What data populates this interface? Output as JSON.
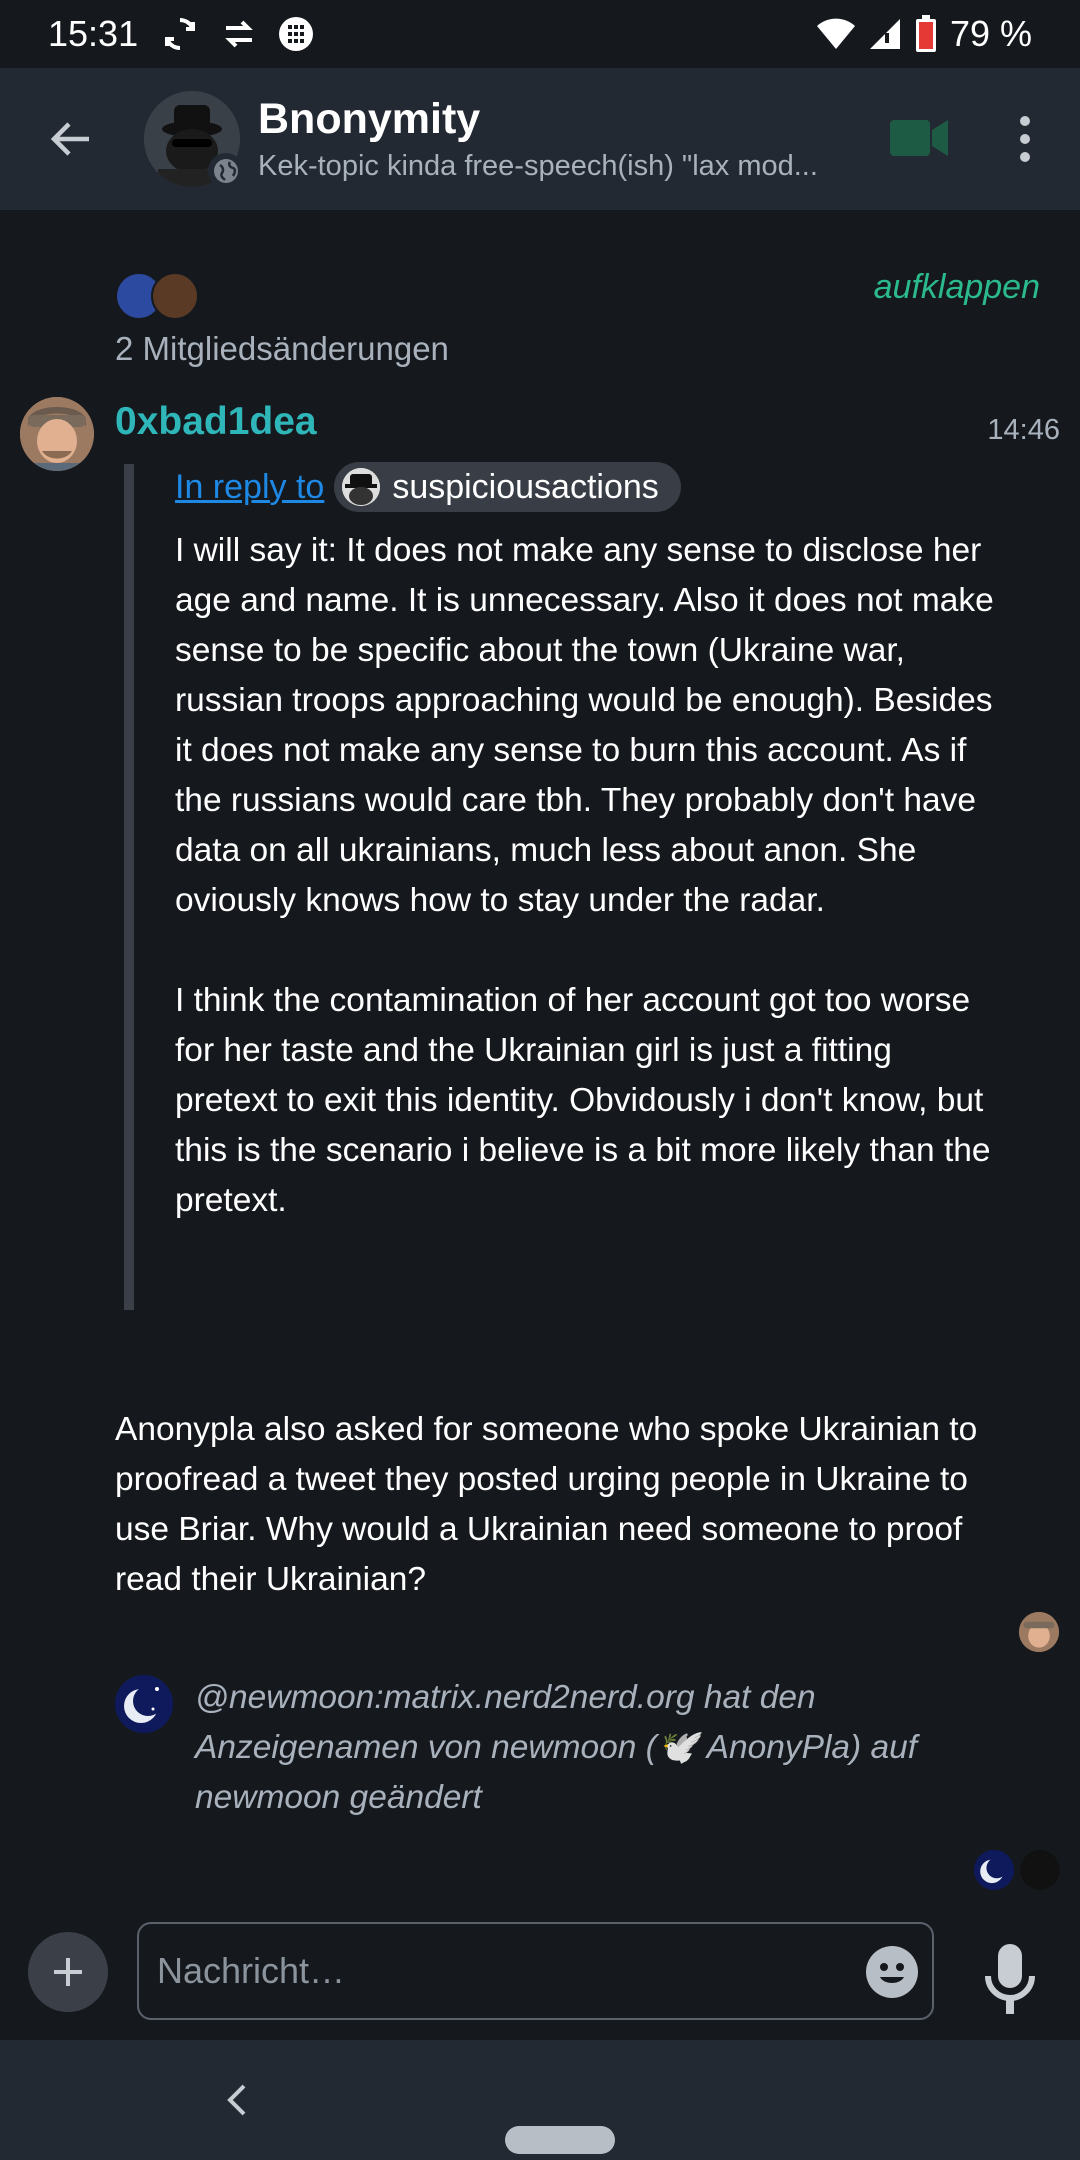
{
  "status_bar": {
    "time": "15:31",
    "left_icons": [
      "sync-icon",
      "data-transfer-icon",
      "grid-app-icon"
    ],
    "right_icons": [
      "wifi-icon",
      "signal-icon",
      "battery-icon"
    ],
    "battery": "79 %"
  },
  "app_bar": {
    "room_name": "Bnonymity",
    "room_topic": "Kek-topic kinda free-speech(ish) \"lax mod...",
    "icons": [
      "back-arrow-icon",
      "video-call-icon",
      "overflow-menu-icon"
    ]
  },
  "timeline": {
    "member_changes": {
      "expand_label": "aufklappen",
      "summary": "2 Mitgliedsänderungen"
    },
    "message": {
      "sender": "0xbad1dea",
      "time": "14:46",
      "reply": {
        "link_text": "In reply to",
        "quoted_user": "suspiciousactions"
      },
      "quote_paragraphs": [
        "I will say it: It does not make any sense to disclose her age and name. It is unnecessary. Also it does not make sense to be specific about the town (Ukraine war, russian troops approaching would be enough). Besides it does not make any sense to burn this account. As if the russians would care tbh. They probably don't have data on all ukrainians, much less about anon. She oviously knows how to stay under the radar.",
        "I think the contamination of her account got too worse for her taste and the Ukrainian girl is just a fitting pretext to exit this identity. Obvidously i don't know, but this is the scenario i believe is a bit more likely than the pretext."
      ],
      "body": "Anonypla also asked for someone who spoke Ukrainian to proofread a tweet they posted urging people in Ukraine to use Briar. Why would a Ukrainian need someone to proof read their Ukrainian?"
    },
    "state_event": {
      "text": "@newmoon:matrix.nerd2nerd.org hat den Anzeigenamen von newmoon (🕊️ AnonyPla) auf newmoon geändert"
    }
  },
  "composer": {
    "placeholder": "Nachricht…",
    "icons": [
      "add-icon",
      "emoji-icon",
      "microphone-icon"
    ]
  },
  "colors": {
    "background": "#15191e",
    "app_bar": "#232932",
    "accent_green": "#2bba8c",
    "sender_name": "#2fb6b9",
    "link_blue": "#1e88e5",
    "secondary_text": "#a9b2bc"
  }
}
